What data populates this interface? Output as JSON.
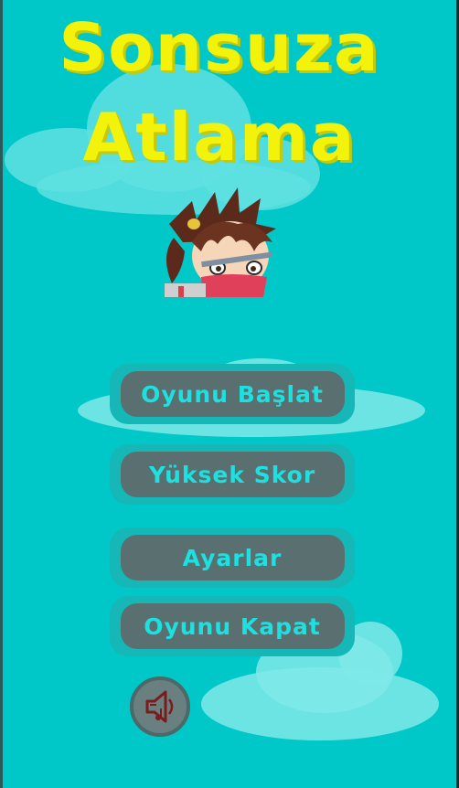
{
  "title": {
    "line1": "Sonsuza",
    "line2": "Atlama"
  },
  "menu": {
    "start_label": "Oyunu Başlat",
    "highscore_label": "Yüksek Skor",
    "settings_label": "Ayarlar",
    "quit_label": "Oyunu Kapat"
  },
  "colors": {
    "background": "#00C8C8",
    "title": "#F2F20A",
    "button_fill": "#5A7070",
    "button_text": "#1DE0E0"
  },
  "icons": {
    "sound": "sound-icon",
    "character": "ninja-girl-character"
  }
}
